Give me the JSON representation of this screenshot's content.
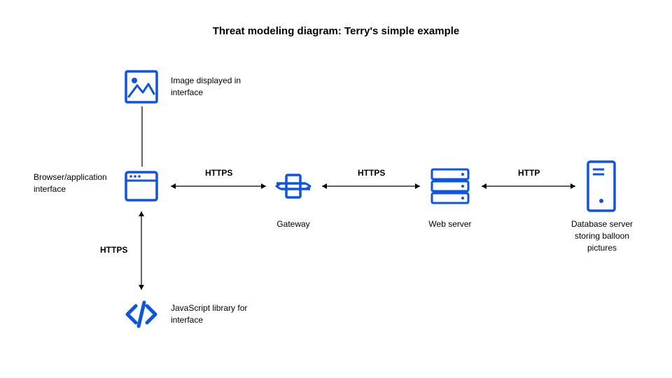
{
  "title": "Threat modeling diagram: Terry's simple example",
  "nodes": {
    "image": {
      "label": "Image displayed in interface"
    },
    "browser": {
      "label": "Browser/application interface"
    },
    "jslib": {
      "label": "JavaScript library for interface"
    },
    "gateway": {
      "label": "Gateway"
    },
    "webserver": {
      "label": "Web server"
    },
    "database": {
      "label": "Database server storing balloon pictures"
    }
  },
  "edges": {
    "browser_gateway": "HTTPS",
    "gateway_webserver": "HTTPS",
    "webserver_database": "HTTP",
    "browser_jslib": "HTTPS"
  },
  "colors": {
    "accent": "#0C53E8"
  }
}
